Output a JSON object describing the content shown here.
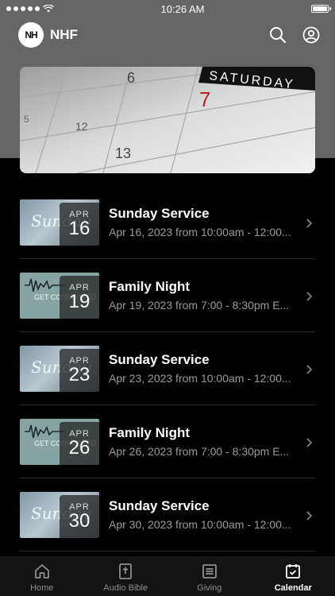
{
  "status_bar": {
    "time": "10:26 AM"
  },
  "header": {
    "logo_text": "NH",
    "title": "NHF"
  },
  "banner": {
    "calendar_text": "SATURDAY",
    "numbers": [
      "6",
      "7",
      "12",
      "13",
      "5"
    ]
  },
  "events": [
    {
      "title": "Sunday Service",
      "subtitle": "Apr 16, 2023 from 10:00am - 12:00...",
      "month": "APR",
      "day": "16",
      "thumb": "Sunday",
      "thumb_type": "sunday"
    },
    {
      "title": "Family Night",
      "subtitle": "Apr 19, 2023 from 7:00 - 8:30pm E...",
      "month": "APR",
      "day": "19",
      "thumb": "GET CONNECTED",
      "thumb_type": "family"
    },
    {
      "title": "Sunday Service",
      "subtitle": "Apr 23, 2023 from 10:00am - 12:00...",
      "month": "APR",
      "day": "23",
      "thumb": "Sunday",
      "thumb_type": "sunday"
    },
    {
      "title": "Family Night",
      "subtitle": "Apr 26, 2023 from 7:00 - 8:30pm E...",
      "month": "APR",
      "day": "26",
      "thumb": "GET CONNECTED",
      "thumb_type": "family"
    },
    {
      "title": "Sunday Service",
      "subtitle": "Apr 30, 2023 from 10:00am - 12:00...",
      "month": "APR",
      "day": "30",
      "thumb": "Sunday",
      "thumb_type": "sunday"
    }
  ],
  "tabs": [
    {
      "label": "Home",
      "icon": "home-icon",
      "active": false
    },
    {
      "label": "Audio Bible",
      "icon": "bible-icon",
      "active": false
    },
    {
      "label": "Giving",
      "icon": "giving-icon",
      "active": false
    },
    {
      "label": "Calendar",
      "icon": "calendar-icon",
      "active": true
    }
  ],
  "colors": {
    "background": "#000000",
    "header_band": "#656565",
    "subtitle": "#9a9a9a",
    "tab_bar": "#131313"
  }
}
